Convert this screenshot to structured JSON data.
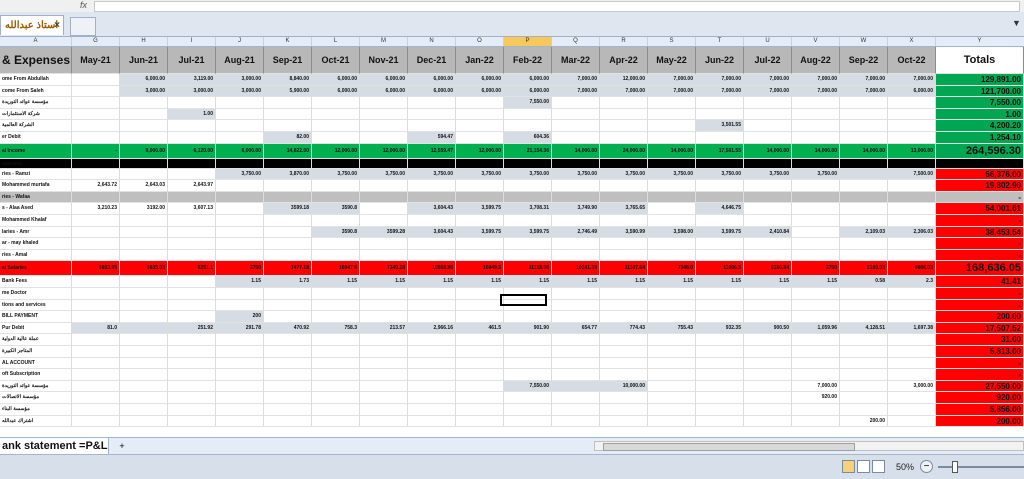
{
  "formula_bar": {
    "fx": "fx"
  },
  "document_tab": {
    "title": "استاذ عبدالله",
    "close": "×"
  },
  "tab_menu": "▼",
  "columns": [
    "A",
    "G",
    "H",
    "I",
    "J",
    "K",
    "L",
    "M",
    "N",
    "O",
    "P",
    "Q",
    "R",
    "S",
    "T",
    "U",
    "V",
    "W",
    "X",
    "Y"
  ],
  "active_column": "P",
  "header": {
    "label": "& Expenses",
    "months": [
      "May-21",
      "Jun-21",
      "Jul-21",
      "Aug-21",
      "Sep-21",
      "Oct-21",
      "Nov-21",
      "Dec-21",
      "Jan-22",
      "Feb-22",
      "Mar-22",
      "Apr-22",
      "May-22",
      "Jun-22",
      "Jul-22",
      "Aug-22",
      "Sep-22",
      "Oct-22"
    ],
    "totals": "Totals"
  },
  "rows": [
    {
      "label": "ome From Abdullah",
      "style": "",
      "cells": [
        "",
        "6,000.00",
        "3,119.00",
        "3,000.00",
        "8,840.00",
        "6,000.00",
        "6,000.00",
        "6,000.00",
        "6,000.00",
        "6,000.00",
        "7,000.00",
        "12,000.00",
        "7,000.00",
        "7,000.00",
        "7,000.00",
        "7,000.00",
        "7,000.00",
        "7,000.00"
      ],
      "total": "129,891.00",
      "total_style": "green",
      "hl": [
        1,
        2,
        3,
        4,
        5,
        6,
        7,
        8,
        9,
        10,
        11,
        12,
        13,
        14,
        15,
        16,
        17
      ]
    },
    {
      "label": "come From Saleh",
      "style": "",
      "cells": [
        "",
        "3,000.00",
        "3,000.00",
        "3,000.00",
        "5,900.00",
        "6,000.00",
        "6,000.00",
        "6,000.00",
        "6,000.00",
        "6,000.00",
        "7,000.00",
        "7,000.00",
        "7,000.00",
        "7,000.00",
        "7,000.00",
        "7,000.00",
        "7,000.00",
        "6,000.00"
      ],
      "total": "121,700.00",
      "total_style": "green",
      "hl": [
        1,
        2,
        3,
        4,
        5,
        6,
        7,
        8,
        9,
        10,
        11,
        12,
        13,
        14,
        15,
        16,
        17
      ]
    },
    {
      "label": "مؤسسة عوائد التوريدة",
      "style": "",
      "cells": [
        "",
        "",
        "",
        "",
        "",
        "",
        "",
        "",
        "",
        "7,550.00",
        "",
        "",
        "",
        "",
        "",
        "",
        "",
        ""
      ],
      "total": "7,550.00",
      "total_style": "green",
      "hl": [
        9
      ]
    },
    {
      "label": "شركة الاستثمارات",
      "style": "",
      "cells": [
        "",
        "",
        "1.00",
        "",
        "",
        "",
        "",
        "",
        "",
        "",
        "",
        "",
        "",
        "",
        "",
        "",
        "",
        ""
      ],
      "total": "1.00",
      "total_style": "green",
      "hl": [
        2
      ]
    },
    {
      "label": "الشركة العالمية",
      "style": "",
      "cells": [
        "",
        "",
        "",
        "",
        "",
        "",
        "",
        "",
        "",
        "",
        "",
        "",
        "",
        "3,501.55",
        "",
        "",
        "",
        ""
      ],
      "total": "4,200.20",
      "total_style": "green",
      "hl": [
        13
      ]
    },
    {
      "label": "er Debit",
      "style": "",
      "cells": [
        "",
        "",
        "",
        "",
        "82.00",
        "",
        "",
        "594.47",
        "",
        "604.36",
        "",
        "",
        "",
        "",
        "",
        "",
        "",
        ""
      ],
      "total": "1,254.10",
      "total_style": "green",
      "hl": [
        4,
        7,
        9
      ]
    },
    {
      "label": "al Income",
      "style": "greenrow",
      "cells": [
        "-",
        "9,000.00",
        "6,120.00",
        "6,000.00",
        "14,822.00",
        "12,000.00",
        "12,000.00",
        "12,559.47",
        "12,000.00",
        "21,154.36",
        "14,000.00",
        "24,000.00",
        "14,000.00",
        "17,501.55",
        "14,000.00",
        "14,000.00",
        "14,000.00",
        "13,000.00"
      ],
      "total": "264,596.30",
      "total_style": "green",
      "hl": []
    },
    {
      "label": "xpenses",
      "style": "blackrow",
      "cells": [
        "",
        "",
        "",
        "",
        "",
        "",
        "",
        "",
        "",
        "",
        "",
        "",
        "",
        "",
        "",
        "",
        "",
        ""
      ],
      "total": "",
      "total_style": "",
      "hl": []
    },
    {
      "label": "ries - Ramzi",
      "style": "",
      "cells": [
        "",
        "",
        "",
        "3,750.00",
        "3,870.00",
        "3,750.00",
        "3,750.00",
        "3,750.00",
        "3,750.00",
        "3,750.00",
        "3,750.00",
        "3,750.00",
        "3,750.00",
        "3,750.00",
        "3,750.00",
        "3,750.00",
        "",
        "7,500.00"
      ],
      "total": "56,376.00",
      "total_style": "red",
      "hl": [
        3,
        4,
        5,
        6,
        7,
        8,
        9,
        10,
        11,
        12,
        13,
        14,
        15,
        16,
        17
      ]
    },
    {
      "label": "Mohammed murtafa",
      "style": "",
      "cells": [
        "2,643.72",
        "2,643.03",
        "2,643.97",
        "",
        "",
        "",
        "",
        "",
        "",
        "",
        "",
        "",
        "",
        "",
        "",
        "",
        "",
        ""
      ],
      "total": "19,802.90",
      "total_style": "red",
      "hl": []
    },
    {
      "label": "ries - Wafaa",
      "style": "greyrow",
      "cells": [
        "",
        "",
        "",
        "",
        "",
        "",
        "",
        "",
        "",
        "",
        "",
        "",
        "",
        "",
        "",
        "",
        "",
        ""
      ],
      "total": "-",
      "total_style": "red",
      "hl": []
    },
    {
      "label": "s - Alaa Ased",
      "style": "",
      "cells": [
        "3,210.23",
        "3192.00",
        "3,607.13",
        "",
        "3599.18",
        "3590.8",
        "",
        "3,604.43",
        "3,599.75",
        "3,708.31",
        "3,749.90",
        "3,765.65",
        "",
        "4,646.75",
        "",
        "",
        "",
        ""
      ],
      "total": "54,001.61",
      "total_style": "red",
      "hl": [
        4,
        5,
        7,
        8,
        9,
        10,
        11,
        13
      ]
    },
    {
      "label": "Mohammed Khalaf",
      "style": "",
      "cells": [
        "",
        "",
        "",
        "",
        "",
        "",
        "",
        "",
        "",
        "",
        "",
        "",
        "",
        "",
        "",
        "",
        "",
        ""
      ],
      "total": "-",
      "total_style": "red",
      "hl": []
    },
    {
      "label": "laries - Amr",
      "style": "",
      "cells": [
        "",
        "",
        "",
        "",
        "",
        "3590.8",
        "3599.28",
        "3,604.43",
        "3,599.75",
        "3,599.75",
        "2,746.49",
        "3,590.99",
        "3,598.00",
        "3,599.75",
        "2,410.84",
        "",
        "2,109.03",
        "2,306.03"
      ],
      "total": "38,453.54",
      "total_style": "red",
      "hl": [
        5,
        6,
        7,
        8,
        9,
        10,
        11,
        12,
        13,
        14,
        16,
        17
      ]
    },
    {
      "label": "ar - may khaled",
      "style": "",
      "cells": [
        "",
        "",
        "",
        "",
        "",
        "",
        "",
        "",
        "",
        "",
        "",
        "",
        "",
        "",
        "",
        "",
        "",
        ""
      ],
      "total": "-",
      "total_style": "red",
      "hl": []
    },
    {
      "label": "ries - Amal",
      "style": "",
      "cells": [
        "",
        "",
        "",
        "",
        "",
        "",
        "",
        "",
        "",
        "",
        "",
        "",
        "",
        "",
        "",
        "",
        "",
        ""
      ],
      "total": "-",
      "total_style": "red",
      "hl": []
    },
    {
      "label": "al Salaries",
      "style": "redrow",
      "cells": [
        "5853.95",
        "5835.03",
        "6251.1",
        "3750",
        "7477.18",
        "10947.6",
        "7349.28",
        "10958.86",
        "10949.5",
        "11158.06",
        "10241.39",
        "11107.64",
        "7348.0",
        "11996.5",
        "6160.84",
        "3750",
        "2109.03",
        "9806.03"
      ],
      "total": "168,636.05",
      "total_style": "red",
      "hl": []
    },
    {
      "label": "Bank Fees",
      "style": "",
      "cells": [
        "",
        "",
        "",
        "1.15",
        "1.73",
        "1.15",
        "1.15",
        "1.15",
        "1.15",
        "1.15",
        "1.15",
        "1.15",
        "1.15",
        "1.15",
        "1.15",
        "1.15",
        "0.58",
        "2.3"
      ],
      "total": "41.41",
      "total_style": "red",
      "hl": [
        3,
        4,
        5,
        6,
        7,
        8,
        9,
        10,
        11,
        12,
        13,
        14,
        15,
        16,
        17
      ]
    },
    {
      "label": "me Doctor",
      "style": "",
      "cells": [
        "",
        "",
        "",
        "",
        "",
        "",
        "",
        "",
        "",
        "",
        "",
        "",
        "",
        "",
        "",
        "",
        "",
        ""
      ],
      "total": "-",
      "total_style": "red",
      "hl": []
    },
    {
      "label": "tions and services",
      "style": "",
      "cells": [
        "",
        "",
        "",
        "",
        "",
        "",
        "",
        "",
        "",
        "",
        "",
        "",
        "",
        "",
        "",
        "",
        "",
        ""
      ],
      "total": "-",
      "total_style": "red",
      "hl": []
    },
    {
      "label": "BILL PAYMENT",
      "style": "",
      "cells": [
        "",
        "",
        "",
        "200",
        "",
        "",
        "",
        "",
        "",
        "",
        "",
        "",
        "",
        "",
        "",
        "",
        "",
        ""
      ],
      "total": "200.00",
      "total_style": "red",
      "hl": [
        3
      ]
    },
    {
      "label": "Pur Debit",
      "style": "",
      "cells": [
        "81.0",
        "",
        "251.92",
        "291.78",
        "470.92",
        "758.3",
        "213.57",
        "2,966.16",
        "461.5",
        "901.90",
        "654.77",
        "774.43",
        "755.43",
        "932.35",
        "900.50",
        "1,059.96",
        "4,128.51",
        "1,697.38"
      ],
      "total": "17,507.52",
      "total_style": "red",
      "hl": [
        0,
        1,
        2,
        3,
        4,
        5,
        6,
        7,
        8,
        9,
        10,
        11,
        12,
        13,
        14,
        15,
        16,
        17
      ]
    },
    {
      "label": "عملة عالية الدولية",
      "style": "",
      "cells": [
        "",
        "",
        "",
        "",
        "",
        "",
        "",
        "",
        "",
        "",
        "",
        "",
        "",
        "",
        "",
        "",
        "",
        ""
      ],
      "total": "31.00",
      "total_style": "red",
      "hl": []
    },
    {
      "label": "المتاجر الكبيرة",
      "style": "",
      "cells": [
        "",
        "",
        "",
        "",
        "",
        "",
        "",
        "",
        "",
        "",
        "",
        "",
        "",
        "",
        "",
        "",
        "",
        ""
      ],
      "total": "5,813.00",
      "total_style": "red",
      "hl": []
    },
    {
      "label": "AL ACCOUNT",
      "style": "",
      "cells": [
        "",
        "",
        "",
        "",
        "",
        "",
        "",
        "",
        "",
        "",
        "",
        "",
        "",
        "",
        "",
        "",
        "",
        ""
      ],
      "total": "-",
      "total_style": "red",
      "hl": []
    },
    {
      "label": "oft Subscription",
      "style": "",
      "cells": [
        "",
        "",
        "",
        "",
        "",
        "",
        "",
        "",
        "",
        "",
        "",
        "",
        "",
        "",
        "",
        "",
        "",
        ""
      ],
      "total": "-",
      "total_style": "red",
      "hl": []
    },
    {
      "label": "مؤسسة عوائد التوريدة",
      "style": "",
      "cells": [
        "",
        "",
        "",
        "",
        "",
        "",
        "",
        "",
        "",
        "7,550.00",
        "",
        "10,000.00",
        "",
        "",
        "",
        "7,000.00",
        "",
        "3,000.00"
      ],
      "total": "27,550.00",
      "total_style": "red",
      "hl": [
        9,
        10,
        11
      ]
    },
    {
      "label": "مؤسسة الاتصالات",
      "style": "",
      "cells": [
        "",
        "",
        "",
        "",
        "",
        "",
        "",
        "",
        "",
        "",
        "",
        "",
        "",
        "",
        "",
        "920.00",
        "",
        ""
      ],
      "total": "920.00",
      "total_style": "red",
      "hl": []
    },
    {
      "label": "مؤسسة البناء",
      "style": "",
      "cells": [
        "",
        "",
        "",
        "",
        "",
        "",
        "",
        "",
        "",
        "",
        "",
        "",
        "",
        "",
        "",
        "",
        "",
        ""
      ],
      "total": "5,856.00",
      "total_style": "red",
      "hl": []
    },
    {
      "label": "اشتراك عبدالله",
      "style": "",
      "cells": [
        "",
        "",
        "",
        "",
        "",
        "",
        "",
        "",
        "",
        "",
        "",
        "",
        "",
        "",
        "",
        "",
        "200.00",
        ""
      ],
      "total": "200.00",
      "total_style": "red",
      "hl": []
    }
  ],
  "sheet": {
    "name": "ank statement =P&L",
    "add": "+"
  },
  "status": {
    "zoom": "50%",
    "minus": "−"
  }
}
